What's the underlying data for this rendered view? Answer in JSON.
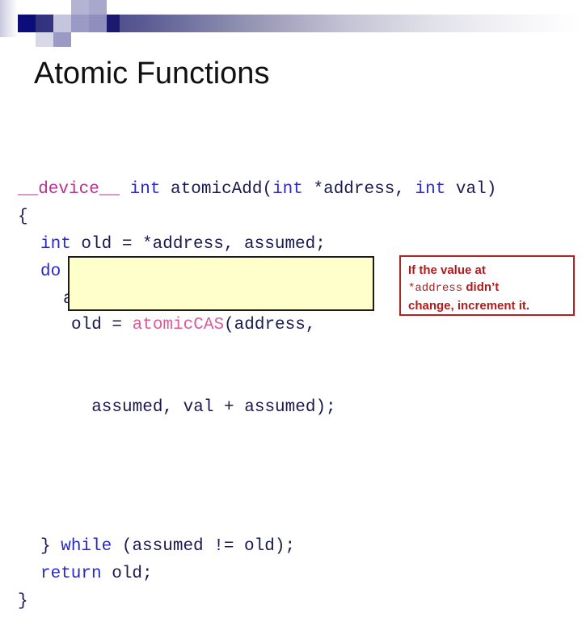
{
  "slide": {
    "title": "Atomic Functions",
    "background_color": "#ffffff"
  },
  "banner": {
    "gradient_from": "#2e2e7a",
    "gradient_to": "#ffffff",
    "accent_square_color": "#0d0d7a"
  },
  "code": {
    "language": "CUDA C",
    "keyword_color": "#2929c7",
    "device_qualifier_color": "#b8318c",
    "atomic_fn_color": "#e05a9a",
    "identifier_color": "#1a1a4e",
    "lines": [
      {
        "indent": 0,
        "tokens": [
          {
            "text": "__device__",
            "kind": "device"
          },
          {
            "text": " ",
            "kind": "plain"
          },
          {
            "text": "int",
            "kind": "keyword"
          },
          {
            "text": " atomicAdd(",
            "kind": "plain"
          },
          {
            "text": "int",
            "kind": "keyword"
          },
          {
            "text": " *address, ",
            "kind": "plain"
          },
          {
            "text": "int",
            "kind": "keyword"
          },
          {
            "text": " val)",
            "kind": "plain"
          }
        ]
      },
      {
        "indent": 0,
        "tokens": [
          {
            "text": "{",
            "kind": "plain"
          }
        ]
      },
      {
        "indent": 1,
        "tokens": [
          {
            "text": "int",
            "kind": "keyword"
          },
          {
            "text": " old = *address, assumed;",
            "kind": "plain"
          }
        ]
      },
      {
        "indent": 1,
        "tokens": [
          {
            "text": "do",
            "kind": "keyword"
          },
          {
            "text": " {",
            "kind": "plain"
          }
        ]
      },
      {
        "indent": 2,
        "tokens": [
          {
            "text": "assumed = old;",
            "kind": "plain"
          }
        ]
      }
    ],
    "tail_lines": [
      {
        "indent": 1,
        "tokens": [
          {
            "text": "} ",
            "kind": "plain"
          },
          {
            "text": "while",
            "kind": "keyword"
          },
          {
            "text": " (assumed != old);",
            "kind": "plain"
          }
        ]
      },
      {
        "indent": 1,
        "tokens": [
          {
            "text": "return",
            "kind": "keyword"
          },
          {
            "text": " old;",
            "kind": "plain"
          }
        ]
      },
      {
        "indent": 0,
        "tokens": [
          {
            "text": "}",
            "kind": "plain"
          }
        ]
      }
    ]
  },
  "highlight": {
    "background_color": "#ffffcc",
    "border_color": "#1a1a1a",
    "line1_prefix": "old = ",
    "line1_fn": "atomicCAS",
    "line1_suffix": "(address,",
    "line2": "  assumed, val + assumed);"
  },
  "callout": {
    "border_color": "#b52020",
    "text_color": "#b01c1c",
    "line1": "If the value at",
    "line2_mono": "*address",
    "line2_bold": " didn’t",
    "line3": "change, increment it."
  }
}
